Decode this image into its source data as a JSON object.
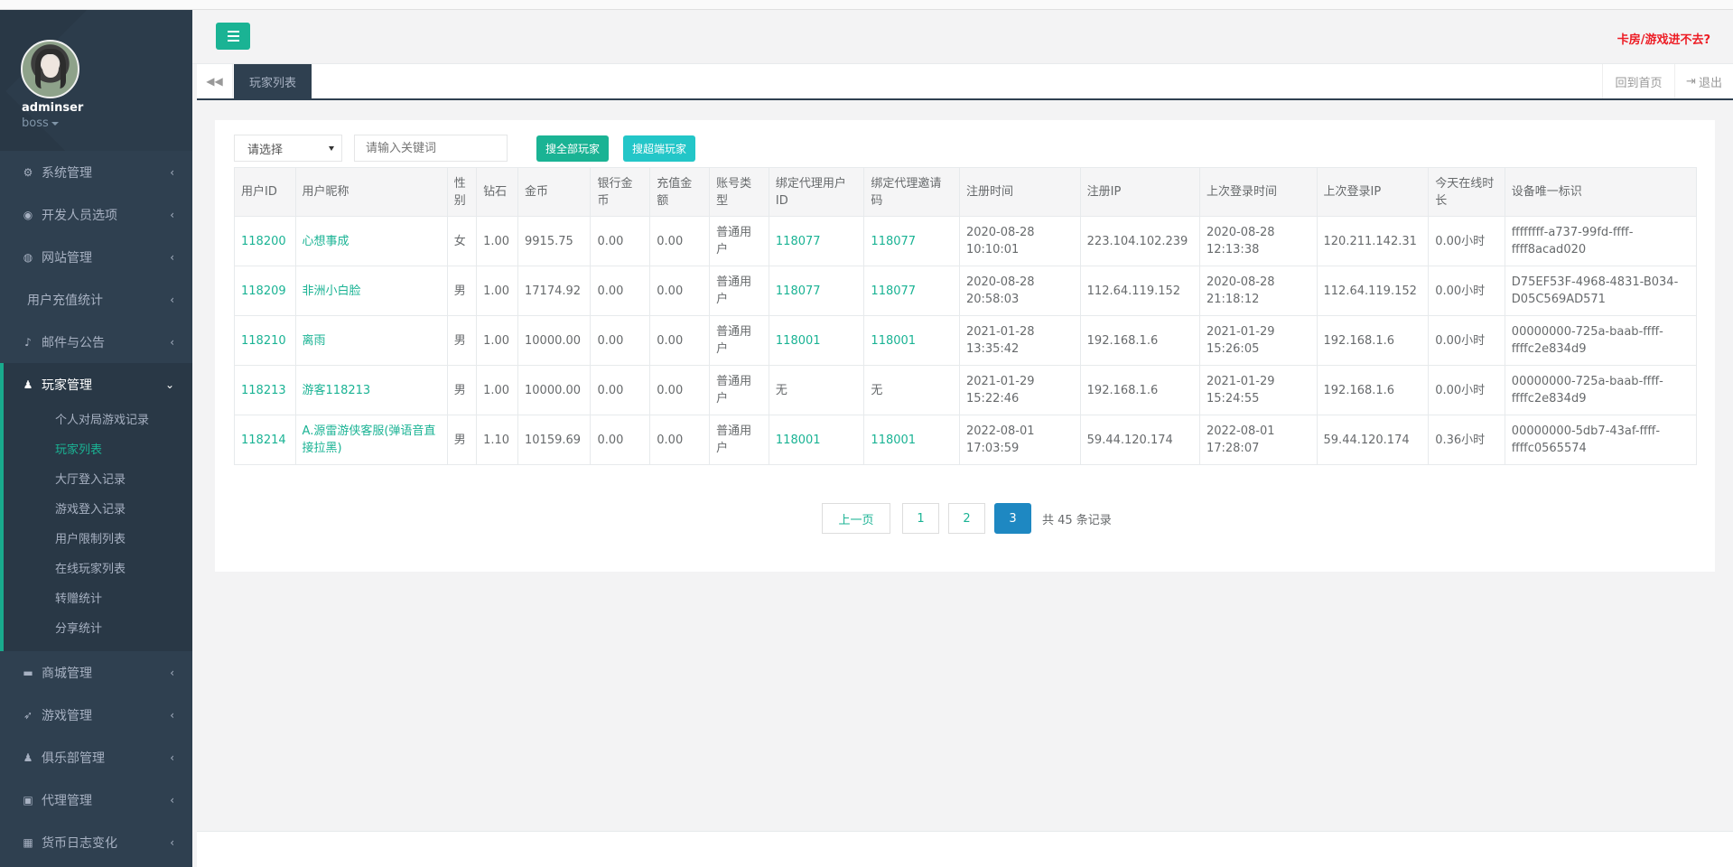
{
  "user": {
    "name": "adminser",
    "role": "boss"
  },
  "header": {
    "warning_link": "卡房/游戏进不去?"
  },
  "sidebar": {
    "items_top": [
      {
        "label": "系统管理",
        "icon": "gears-icon"
      },
      {
        "label": "开发人员选项",
        "icon": "gamepad-icon"
      },
      {
        "label": "网站管理",
        "icon": "globe-icon"
      },
      {
        "label": "用户充值统计",
        "icon": ""
      },
      {
        "label": "邮件与公告",
        "icon": "bell-icon"
      },
      {
        "label": "玩家管理",
        "icon": "user-icon"
      }
    ],
    "sub_items": [
      "个人对局游戏记录",
      "玩家列表",
      "大厅登入记录",
      "游戏登入记录",
      "用户限制列表",
      "在线玩家列表",
      "转赠统计",
      "分享统计"
    ],
    "items_bottom": [
      {
        "label": "商城管理",
        "icon": "cart-icon"
      },
      {
        "label": "游戏管理",
        "icon": "rocket-icon"
      },
      {
        "label": "俱乐部管理",
        "icon": "users-icon"
      },
      {
        "label": "代理管理",
        "icon": "lock-icon"
      },
      {
        "label": "货币日志变化",
        "icon": "calendar-icon"
      }
    ]
  },
  "tabs": {
    "active": "玩家列表",
    "home": "回到首页",
    "logout": "退出"
  },
  "filter": {
    "select_value": "请选择",
    "keyword_placeholder": "请输入关键词",
    "btn_all": "搜全部玩家",
    "btn_super": "搜超端玩家"
  },
  "table": {
    "headers": [
      "用户ID",
      "用户昵称",
      "性别",
      "钻石",
      "金币",
      "银行金币",
      "充值金额",
      "账号类型",
      "绑定代理用户ID",
      "绑定代理邀请码",
      "注册时间",
      "注册IP",
      "上次登录时间",
      "上次登录IP",
      "今天在线时长",
      "设备唯一标识"
    ],
    "rows": [
      [
        "118200",
        "心想事成",
        "女",
        "1.00",
        "9915.75",
        "0.00",
        "0.00",
        "普通用户",
        "118077",
        "118077",
        "2020-08-28 10:10:01",
        "223.104.102.239",
        "2020-08-28 12:13:38",
        "120.211.142.31",
        "0.00小时",
        "ffffffff-a737-99fd-ffff-ffff8acad020"
      ],
      [
        "118209",
        "非洲小白脸",
        "男",
        "1.00",
        "17174.92",
        "0.00",
        "0.00",
        "普通用户",
        "118077",
        "118077",
        "2020-08-28 20:58:03",
        "112.64.119.152",
        "2020-08-28 21:18:12",
        "112.64.119.152",
        "0.00小时",
        "D75EF53F-4968-4831-B034-D05C569AD571"
      ],
      [
        "118210",
        "离雨",
        "男",
        "1.00",
        "10000.00",
        "0.00",
        "0.00",
        "普通用户",
        "118001",
        "118001",
        "2021-01-28 13:35:42",
        "192.168.1.6",
        "2021-01-29 15:26:05",
        "192.168.1.6",
        "0.00小时",
        "00000000-725a-baab-ffff-ffffc2e834d9"
      ],
      [
        "118213",
        "游客118213",
        "男",
        "1.00",
        "10000.00",
        "0.00",
        "0.00",
        "普通用户",
        "无",
        "无",
        "2021-01-29 15:22:46",
        "192.168.1.6",
        "2021-01-29 15:24:55",
        "192.168.1.6",
        "0.00小时",
        "00000000-725a-baab-ffff-ffffc2e834d9"
      ],
      [
        "118214",
        "A.源雷游侠客服(弹语音直接拉黑)",
        "男",
        "1.10",
        "10159.69",
        "0.00",
        "0.00",
        "普通用户",
        "118001",
        "118001",
        "2022-08-01 17:03:59",
        "59.44.120.174",
        "2022-08-01 17:28:07",
        "59.44.120.174",
        "0.36小时",
        "00000000-5db7-43af-ffff-ffffc0565574"
      ]
    ]
  },
  "pagination": {
    "prev": "上一页",
    "pages": [
      "1",
      "2",
      "3"
    ],
    "current": "3",
    "total_text": "共 45 条记录"
  }
}
